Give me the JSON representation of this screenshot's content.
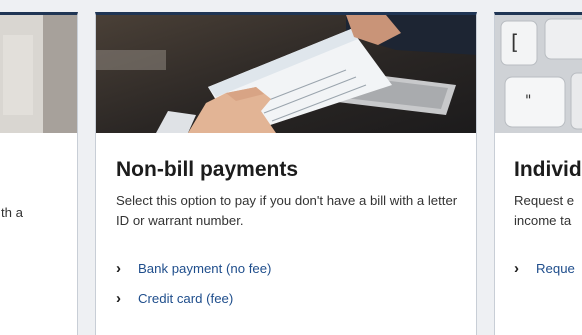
{
  "cards": [
    {
      "visible_text": "th a"
    },
    {
      "title": "Non-bill payments",
      "description": "Select this option to pay if you don't have a bill with a letter ID or warrant number.",
      "links": [
        {
          "label": "Bank payment (no fee)",
          "icon": "chevron-right-icon"
        },
        {
          "label": "Credit card (fee)",
          "icon": "chevron-right-icon"
        }
      ]
    },
    {
      "title": "Individ",
      "description_line1": "Request e",
      "description_line2": "income ta",
      "links": [
        {
          "label": "Reque",
          "icon": "chevron-right-icon"
        }
      ]
    }
  ],
  "icons": {
    "chevron": "›"
  },
  "colors": {
    "accent_border": "#1f3554",
    "link": "#1f4e8c",
    "page_bg": "#eef0f3"
  }
}
